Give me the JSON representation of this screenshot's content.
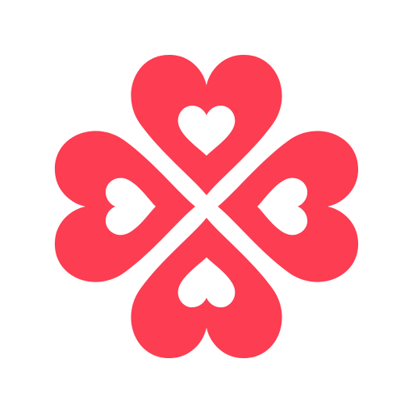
{
  "logo": {
    "icon": "four-heart-clover-icon",
    "petal_count": 4,
    "colors": {
      "primary": "#FC3D52",
      "background": "#FFFFFF",
      "inner_heart": "#FFFFFF"
    }
  }
}
